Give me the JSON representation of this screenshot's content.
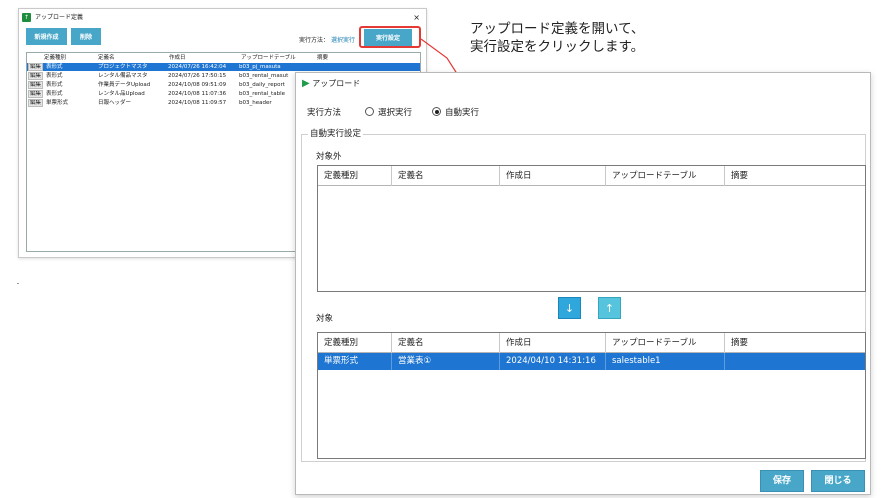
{
  "back_window": {
    "title": "アップロード定義",
    "close": "×",
    "buttons": {
      "new": "新規作成",
      "delete": "削除",
      "exec_settings": "実行設定"
    },
    "exec_method_label": "実行方法：",
    "exec_method_value": "選択実行",
    "columns": [
      "定義種別",
      "定義名",
      "作成日",
      "アップロードテーブル",
      "摘要"
    ],
    "rows": [
      {
        "edit": "編集",
        "type": "表形式",
        "name": "プロジェクトマスタ",
        "created": "2024/07/26 16:42:04",
        "table": "b03_pj_masuta",
        "selected": true
      },
      {
        "edit": "編集",
        "type": "表形式",
        "name": "レンタル備品マスタ",
        "created": "2024/07/26 17:50:15",
        "table": "b03_rental_masut",
        "selected": false
      },
      {
        "edit": "編集",
        "type": "表形式",
        "name": "作業員データUpload",
        "created": "2024/10/08 09:51:09",
        "table": "b03_daily_report",
        "selected": false
      },
      {
        "edit": "編集",
        "type": "表形式",
        "name": "レンタル品Upload",
        "created": "2024/10/08 11:07:36",
        "table": "b03_rental_table",
        "selected": false
      },
      {
        "edit": "編集",
        "type": "単票形式",
        "name": "日報ヘッダー",
        "created": "2024/10/08 11:09:57",
        "table": "b03_header",
        "selected": false
      }
    ]
  },
  "annotation": {
    "line1": "アップロード定義を開いて、",
    "line2": "実行設定をクリックします。",
    "callout_color": "#e53935"
  },
  "dialog": {
    "title": "アップロード",
    "title_icon": "play-triangle-icon",
    "exec_method_label": "実行方法",
    "radio_options": [
      {
        "label": "選択実行",
        "selected": false
      },
      {
        "label": "自動実行",
        "selected": true
      }
    ],
    "group_label": "自動実行設定",
    "excluded_label": "対象外",
    "included_label": "対象",
    "columns": [
      "定義種別",
      "定義名",
      "作成日",
      "アップロードテーブル",
      "摘要"
    ],
    "excluded_rows": [],
    "included_rows": [
      {
        "type": "単票形式",
        "name": "営業表①",
        "created": "2024/04/10 14:31:16",
        "table": "salestable1",
        "note": ""
      }
    ],
    "move_down": "↓",
    "move_up": "↑",
    "save": "保存",
    "close": "閉じる"
  },
  "colors": {
    "button": "#48a7c9",
    "selection": "#1f76d2",
    "accent_green": "#1e9e4a"
  }
}
